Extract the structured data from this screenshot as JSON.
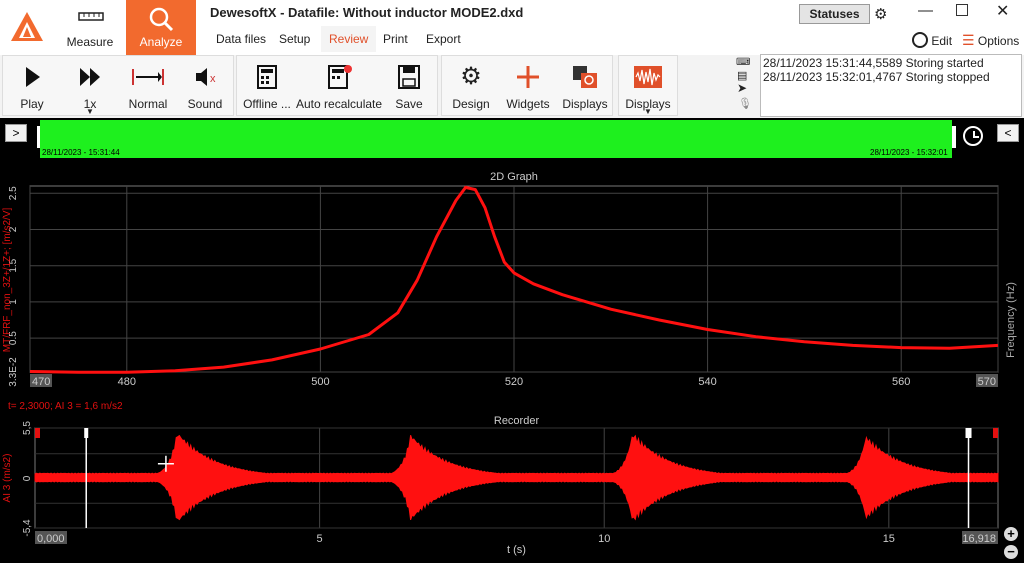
{
  "app": {
    "title": "DewesoftX - Datafile: Without inductor MODE2.dxd",
    "statuses_label": "Statuses",
    "edit_label": "Edit",
    "options_label": "Options",
    "modes": {
      "measure": "Measure",
      "analyze": "Analyze"
    },
    "menu": [
      "Data files",
      "Setup",
      "Review",
      "Print",
      "Export"
    ]
  },
  "ribbon": {
    "play": "Play",
    "speed": "1x",
    "normal": "Normal",
    "sound": "Sound",
    "offline": "Offline ...",
    "auto_recalculate": "Auto recalculate",
    "save": "Save",
    "design": "Design",
    "widgets": "Widgets",
    "displays": "Displays",
    "displays2": "Displays"
  },
  "log": [
    "28/11/2023 15:31:44,5589 Storing started",
    "28/11/2023 15:32:01,4767 Storing stopped"
  ],
  "timeline": {
    "start_label": "28/11/2023 - 15:31:44",
    "end_label": "28/11/2023 - 15:32:01",
    "colors": {
      "bar": "#1ef01e"
    }
  },
  "chart_data": [
    {
      "type": "line",
      "title": "2D Graph",
      "xlabel": "Frequency (Hz)",
      "ylabel": "MT/FRF_non_3Z+/1Z+; [m/s2/V]",
      "xlim": [
        470,
        570
      ],
      "ylim": [
        0.033,
        2.6
      ],
      "x_ticks": [
        "470",
        "480",
        "500",
        "520",
        "540",
        "560",
        "570"
      ],
      "y_ticks": [
        "3.3E-2",
        "0.5",
        "1",
        "1.5",
        "2",
        "2.5"
      ],
      "series": [
        {
          "color": "#ff1010",
          "x": [
            470,
            475,
            480,
            485,
            490,
            495,
            500,
            505,
            508,
            510,
            512,
            514,
            515,
            516,
            517,
            518,
            519,
            520,
            522,
            525,
            530,
            535,
            540,
            545,
            550,
            555,
            560,
            565,
            570
          ],
          "y": [
            0.04,
            0.03,
            0.03,
            0.05,
            0.1,
            0.2,
            0.35,
            0.55,
            0.85,
            1.3,
            1.9,
            2.4,
            2.58,
            2.55,
            2.3,
            1.9,
            1.55,
            1.4,
            1.25,
            1.1,
            0.9,
            0.75,
            0.62,
            0.52,
            0.45,
            0.4,
            0.37,
            0.36,
            0.4
          ]
        }
      ]
    },
    {
      "type": "line",
      "title": "Recorder",
      "readout": "t= 2,3000; AI 3 = 1,6 m/s2",
      "xlabel": "t (s)",
      "ylabel": "AI 3 (m/s2)",
      "xlim": [
        0,
        16.918
      ],
      "ylim": [
        -5.4,
        5.5
      ],
      "x_ticks": [
        "0,000",
        "5",
        "10",
        "15",
        "16,918"
      ],
      "y_ticks": [
        "5,5",
        "0",
        "-5,4"
      ],
      "bursts": [
        {
          "t": 2.5,
          "amp": 5.3
        },
        {
          "t": 6.6,
          "amp": 5.0
        },
        {
          "t": 10.5,
          "amp": 5.2
        },
        {
          "t": 14.6,
          "amp": 4.8
        }
      ]
    }
  ]
}
